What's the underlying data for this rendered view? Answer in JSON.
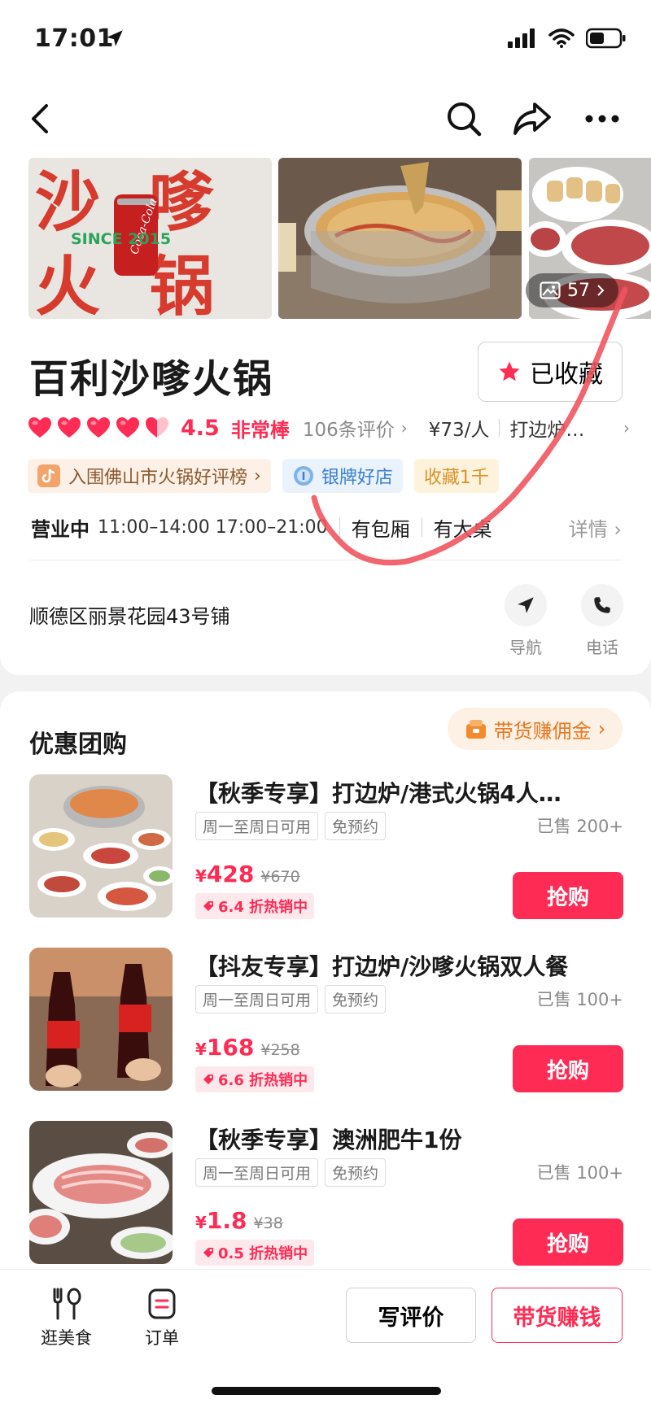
{
  "status_bar": {
    "time": "17:01"
  },
  "shop": {
    "name": "百利沙嗲火锅",
    "favorite_label": "已收藏",
    "rating_score": "4.5",
    "rating_word": "非常棒",
    "review_count": "106条评价",
    "price_per_person": "¥73/人",
    "category": "打边炉…",
    "tags": [
      "入围佛山市火锅好评榜",
      "银牌好店",
      "收藏1千"
    ],
    "hours_status": "营业中",
    "hours": "11:00–14:00 17:00–21:00",
    "feature_1": "有包厢",
    "feature_2": "有大桌",
    "details": "详情",
    "address": "顺德区丽景花园43号铺",
    "nav_label": "导航",
    "phone_label": "电话",
    "photo_count": "57",
    "poster_text": "SINCE 2015"
  },
  "deals": {
    "title": "优惠团购",
    "commission_label": "带货赚佣金",
    "items": [
      {
        "title": "【秋季专享】打边炉/港式火锅4人…",
        "chip1": "周一至周日可用",
        "chip2": "免预约",
        "sold": "已售 200+",
        "price": "428",
        "old_price": "¥670",
        "discount": "6.4 折热销中",
        "buy": "抢购"
      },
      {
        "title": "【抖友专享】打边炉/沙嗲火锅双人餐",
        "chip1": "周一至周日可用",
        "chip2": "免预约",
        "sold": "已售 100+",
        "price": "168",
        "old_price": "¥258",
        "discount": "6.6 折热销中",
        "buy": "抢购"
      },
      {
        "title": "【秋季专享】澳洲肥牛1份",
        "chip1": "周一至周日可用",
        "chip2": "免预约",
        "sold": "已售 100+",
        "price": "1.8",
        "old_price": "¥38",
        "discount": "0.5 折热销中",
        "buy": "抢购"
      }
    ]
  },
  "bottom_bar": {
    "tab1": "逛美食",
    "tab2": "订单",
    "review_button": "写评价",
    "earn_button": "带货赚钱"
  },
  "colors": {
    "accent": "#fe2c55",
    "orange": "#e9771f",
    "annotation": "#f0555f"
  }
}
